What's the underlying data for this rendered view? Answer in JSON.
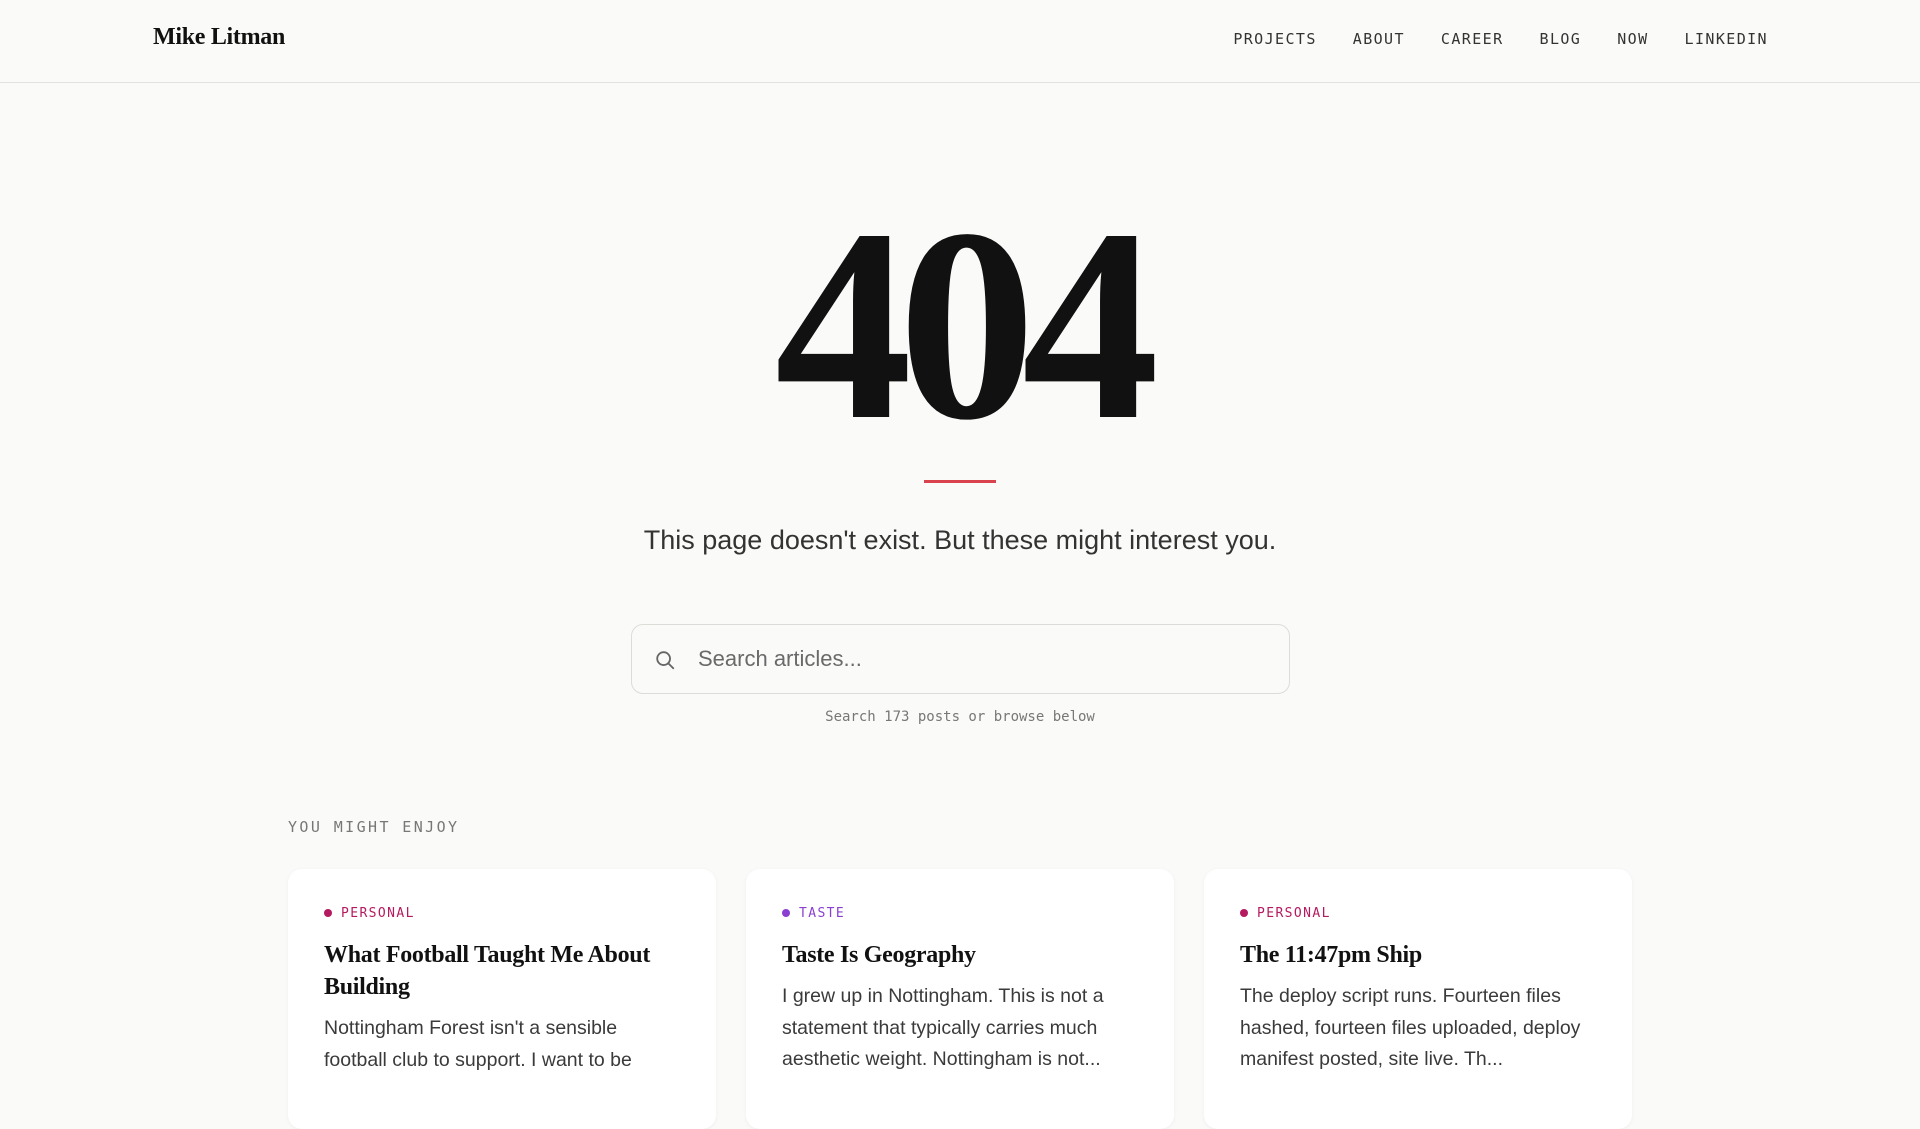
{
  "header": {
    "logo": "Mike Litman",
    "nav": [
      "PROJECTS",
      "ABOUT",
      "CAREER",
      "BLOG",
      "NOW",
      "LINKEDIN"
    ]
  },
  "hero": {
    "code": "404",
    "message": "This page doesn't exist. But these might interest you.",
    "accent_color": "#d9434e"
  },
  "search": {
    "icon": "search-icon",
    "placeholder": "Search articles...",
    "value": "",
    "hint": "Search 173 posts or browse below"
  },
  "suggestions": {
    "label": "YOU MIGHT ENJOY",
    "cards": [
      {
        "category": "PERSONAL",
        "category_color": "#b5195f",
        "title": "What Football Taught Me About Building",
        "excerpt": "Nottingham Forest isn't a sensible football club to support. I want to be"
      },
      {
        "category": "TASTE",
        "category_color": "#8a3fd1",
        "title": "Taste Is Geography",
        "excerpt": "I grew up in Nottingham. This is not a statement that typically carries much aesthetic weight. Nottingham is not..."
      },
      {
        "category": "PERSONAL",
        "category_color": "#b5195f",
        "title": "The 11:47pm Ship",
        "excerpt": "The deploy script runs. Fourteen files hashed, fourteen files uploaded, deploy manifest posted, site live. Th..."
      }
    ]
  }
}
